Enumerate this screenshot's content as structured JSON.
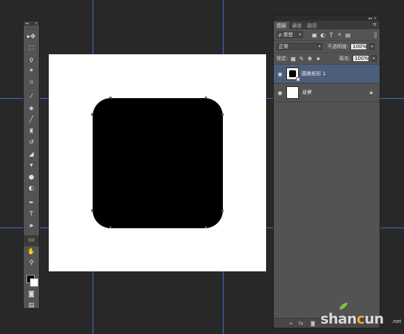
{
  "toolbar": {
    "collapse_label": "◂◂",
    "close_label": "×",
    "tools": [
      {
        "name": "move-tool",
        "icon": "move-icon",
        "glyph": "▸✥"
      },
      {
        "name": "marquee-tool",
        "icon": "marquee-icon",
        "glyph": "⬚"
      },
      {
        "name": "lasso-tool",
        "icon": "lasso-icon",
        "glyph": "ϙ"
      },
      {
        "name": "magic-wand-tool",
        "icon": "magic-wand-icon",
        "glyph": "✴"
      },
      {
        "name": "crop-tool",
        "icon": "crop-icon",
        "glyph": "⌗"
      },
      {
        "name": "eyedropper-tool",
        "icon": "eyedropper-icon",
        "glyph": "⁄"
      },
      {
        "name": "healing-brush-tool",
        "icon": "bandage-icon",
        "glyph": "◈"
      },
      {
        "name": "brush-tool",
        "icon": "brush-icon",
        "glyph": "╱"
      },
      {
        "name": "clone-stamp-tool",
        "icon": "stamp-icon",
        "glyph": "♜"
      },
      {
        "name": "history-brush-tool",
        "icon": "history-brush-icon",
        "glyph": "↺"
      },
      {
        "name": "eraser-tool",
        "icon": "eraser-icon",
        "glyph": "◢"
      },
      {
        "name": "paint-bucket-tool",
        "icon": "bucket-icon",
        "glyph": "▾"
      },
      {
        "name": "blur-tool",
        "icon": "droplet-icon",
        "glyph": "●"
      },
      {
        "name": "dodge-tool",
        "icon": "dodge-icon",
        "glyph": "◐"
      },
      {
        "name": "pen-tool",
        "icon": "pen-icon",
        "glyph": "✒"
      },
      {
        "name": "type-tool",
        "icon": "type-icon",
        "glyph": "T"
      },
      {
        "name": "path-selection-tool",
        "icon": "arrow-icon",
        "glyph": "➤"
      },
      {
        "name": "rounded-rectangle-tool",
        "icon": "rounded-rect-icon",
        "glyph": "▭",
        "active": true
      },
      {
        "name": "hand-tool",
        "icon": "hand-icon",
        "glyph": "✋"
      },
      {
        "name": "zoom-tool",
        "icon": "zoom-icon",
        "glyph": "⚲"
      }
    ],
    "quick_mask_icon": "quick-mask-icon",
    "screen_mode_icon": "screen-mode-icon"
  },
  "canvas": {
    "background": "#ffffff",
    "shape_fill": "#000000",
    "guide_color": "#4a6ad8"
  },
  "panel": {
    "tabs": [
      "图层",
      "通道",
      "路径"
    ],
    "active_tab": 0,
    "filter": {
      "kind": "ρ 类型",
      "icons": [
        "image-filter-icon",
        "adjustment-filter-icon",
        "type-filter-icon",
        "shape-filter-icon",
        "smart-object-filter-icon"
      ]
    },
    "blend_mode": "正常",
    "opacity_label": "不透明度:",
    "opacity_value": "100%",
    "lock_label": "锁定:",
    "fill_label": "填充:",
    "fill_value": "100%",
    "layers": [
      {
        "name": "圆角矩形 1",
        "visible": true,
        "selected": true,
        "type": "shape"
      },
      {
        "name": "背景",
        "visible": true,
        "selected": false,
        "type": "background",
        "locked": true
      }
    ],
    "bottom_icons": [
      {
        "name": "link-layers-icon",
        "glyph": "∞"
      },
      {
        "name": "layer-style-icon",
        "glyph": "fx."
      },
      {
        "name": "add-mask-icon",
        "glyph": "◙"
      }
    ]
  },
  "watermark": {
    "brand_start": "shan",
    "brand_mid": "c",
    "brand_end": "un",
    "suffix": ".net"
  }
}
